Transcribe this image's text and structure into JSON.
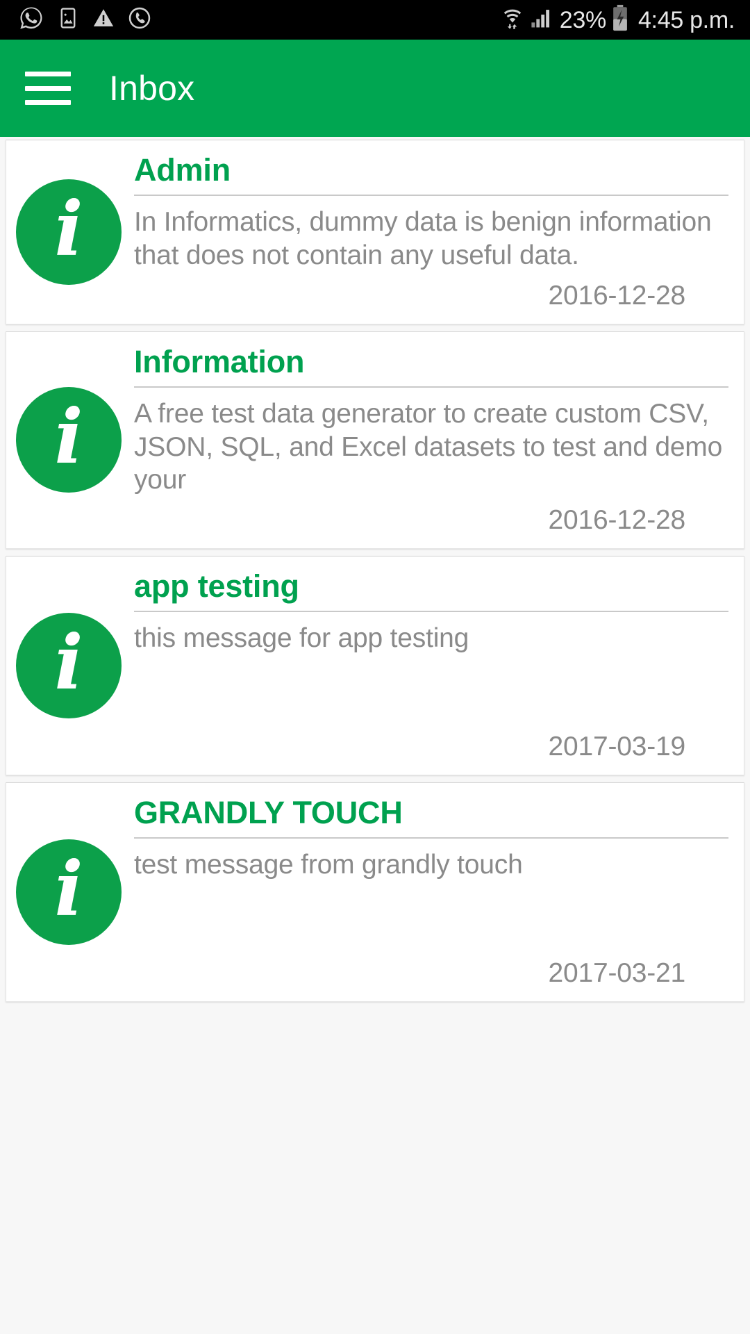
{
  "status_bar": {
    "left_icons": [
      {
        "name": "whatsapp-icon",
        "label": "WhatsApp"
      },
      {
        "name": "screenshot-icon",
        "label": "Screenshot"
      },
      {
        "name": "warning-icon",
        "label": "Warning"
      },
      {
        "name": "call-icon",
        "label": "Call"
      }
    ],
    "right_icons": [
      {
        "name": "wifi-icon",
        "label": "Wi-Fi"
      },
      {
        "name": "signal-icon",
        "label": "Signal"
      },
      {
        "name": "battery-charging-icon",
        "label": "Battery charging"
      }
    ],
    "battery_percent": "23%",
    "clock": "4:45 p.m."
  },
  "app_bar": {
    "menu_icon": "hamburger-menu-icon",
    "title": "Inbox",
    "background_color": "#00a651",
    "title_color": "#ffffff"
  },
  "theme": {
    "accent_green": "#00a651",
    "icon_green": "#0ca04a",
    "title_green": "#00a14f",
    "body_gray": "#8a8a8a",
    "divider_gray": "#c9c9c9",
    "page_background": "#f7f7f7",
    "card_background": "#ffffff"
  },
  "inbox": {
    "messages": [
      {
        "icon": "info-icon",
        "icon_glyph": "i",
        "title": "Admin",
        "text": "In Informatics, dummy data is benign information that does not contain any useful data.",
        "date": "2016-12-28"
      },
      {
        "icon": "info-icon",
        "icon_glyph": "i",
        "title": "Information",
        "text": "A free test data generator to create custom CSV, JSON, SQL, and Excel datasets to test and demo your",
        "date": "2016-12-28"
      },
      {
        "icon": "info-icon",
        "icon_glyph": "i",
        "title": "app testing",
        "text": "this message for app testing",
        "date": "2017-03-19"
      },
      {
        "icon": "info-icon",
        "icon_glyph": "i",
        "title": "GRANDLY TOUCH",
        "text": "test message from grandly touch",
        "date": "2017-03-21"
      }
    ]
  }
}
